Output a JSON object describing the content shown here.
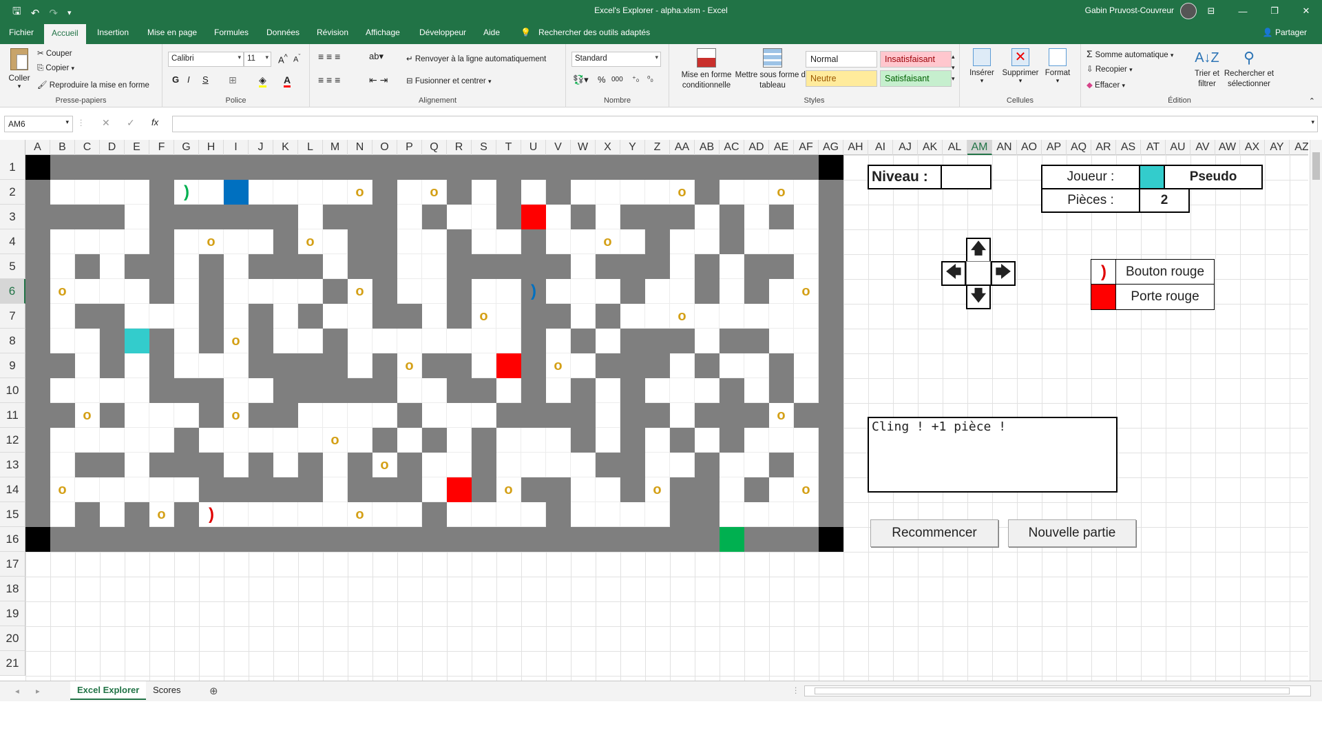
{
  "titlebar": {
    "title": "Excel's Explorer - alpha.xlsm  -  Excel",
    "user": "Gabin Pruvost-Couvreur",
    "buttons": [
      "⊟",
      "—",
      "❐",
      "✕"
    ]
  },
  "tabs": [
    "Fichier",
    "Accueil",
    "Insertion",
    "Mise en page",
    "Formules",
    "Données",
    "Révision",
    "Affichage",
    "Développeur",
    "Aide"
  ],
  "tab_search": "Rechercher des outils adaptés",
  "share": "Partager",
  "ribbon": {
    "paste": "Coller",
    "cut": "Couper",
    "copy": "Copier",
    "format_painter": "Reproduire la mise en forme",
    "clipboard_label": "Presse-papiers",
    "font_name": "Calibri",
    "font_size": "11",
    "font_label": "Police",
    "wrap": "Renvoyer à la ligne automatiquement",
    "merge": "Fusionner et centrer",
    "align_label": "Alignement",
    "number_format": "Standard",
    "number_label": "Nombre",
    "cond_format": "Mise en forme conditionnelle",
    "table_format": "Mettre sous forme de tableau",
    "styles": {
      "normal": "Normal",
      "bad": "Insatisfaisant",
      "neutral": "Neutre",
      "good": "Satisfaisant"
    },
    "styles_label": "Styles",
    "insert": "Insérer",
    "delete": "Supprimer",
    "format": "Format",
    "cells_label": "Cellules",
    "autosum": "Somme automatique",
    "fill": "Recopier",
    "clear": "Effacer",
    "sort": "Trier et filtrer",
    "find": "Rechercher et sélectionner",
    "editing_label": "Édition"
  },
  "namebox": "AM6",
  "columns": [
    "A",
    "B",
    "C",
    "D",
    "E",
    "F",
    "G",
    "H",
    "I",
    "J",
    "K",
    "L",
    "M",
    "N",
    "O",
    "P",
    "Q",
    "R",
    "S",
    "T",
    "U",
    "V",
    "W",
    "X",
    "Y",
    "Z",
    "AA",
    "AB",
    "AC",
    "AD",
    "AE",
    "AF",
    "AG",
    "AH",
    "AI",
    "AJ",
    "AK",
    "AL",
    "AM",
    "AN",
    "AO",
    "AP",
    "AQ",
    "AR",
    "AS",
    "AT",
    "AU",
    "AV",
    "AW",
    "AX",
    "AY",
    "AZ"
  ],
  "rows": [
    "1",
    "2",
    "3",
    "4",
    "5",
    "6",
    "7",
    "8",
    "9",
    "10",
    "11",
    "12",
    "13",
    "14",
    "15",
    "16",
    "17",
    "18",
    "19",
    "20",
    "21"
  ],
  "selected_col": "AM",
  "selected_row": "6",
  "maze": {
    "legend": "W=wall F=floor K=corner P=player G=exit R=red door B=blue key o=coin (=green button )=red button",
    "map": [
      "KWWWWWWWWWWWWWWWWWWWWWWWWWWWWWWWK",
      "WFFFFWFFBFFFFoWFoWFWFWFFFFoWFFoFW",
      "WWWWFWWWWWWFWWWFWFFWRFWFWWWFWFWFW",
      "WFFFFWFoFFWoFWWFFWFFWFFoFWFFWFFFW",
      "WFWFWWFWFWWWFWWFFWWWWWFWWWFWFWWFW",
      "WoFFFWFWFFFFWoWFFWFFWFFFWFFWFWFoW",
      "WFWWFFFWFWFWFFWWFWoFWWFWFFoFFFFFW",
      "WFFWPWFWoWFFWFFFFFFFWFWFWWWFWWFFW",
      "WWFWFWFFFWWWWFWoWWFRWoFWWWFWFFWFW",
      "WFFFFWWWFFWWWWWFFWWFWFWFWFFFWFWFW",
      "WWoWFFFWoWWFFFFWFFFWWWWFWWFWWWoWW",
      "WFFFFFWFFFFFoFWFWFWFFFWFWFWFWFFFW",
      "WFWWFWWWFWFWFWoWFFWFFFFWWFFWFFWFW",
      "WoFFFFFWWWWWFWWWFRWoWWFFWoWWFWFoW",
      "WFWFWoWFFFFFFoFFWFFFFWFFFFWWFFFFW",
      "KWWWWWWWWWWWWWWWWWWWWWWWWWWWGWWWK"
    ],
    "specials": [
      {
        "cell": "G2",
        "glyph": ")",
        "color": "#00b050"
      },
      {
        "cell": "H15",
        "glyph": ")",
        "color": "#e00000"
      },
      {
        "cell": "U6",
        "glyph": ")",
        "color": "#0070c0"
      }
    ],
    "colors": {
      "wall": "#7f7f7f",
      "corner": "#000000",
      "player": "#33cccc",
      "exit": "#00b050",
      "red_door": "#ff0000",
      "blue_key": "#0070c0",
      "coin": "#d4a017"
    }
  },
  "panel": {
    "niveau_label": "Niveau :",
    "niveau_value": "",
    "joueur_label": "Joueur :",
    "pseudo": "Pseudo",
    "pieces_label": "Pièces :",
    "pieces_value": "2",
    "legend_btn_label": "Bouton rouge",
    "legend_door_label": "Porte rouge",
    "message": "Cling ! +1 pièce !",
    "restart": "Recommencer",
    "new_game": "Nouvelle partie"
  },
  "sheets": [
    "Excel Explorer",
    "Scores"
  ]
}
